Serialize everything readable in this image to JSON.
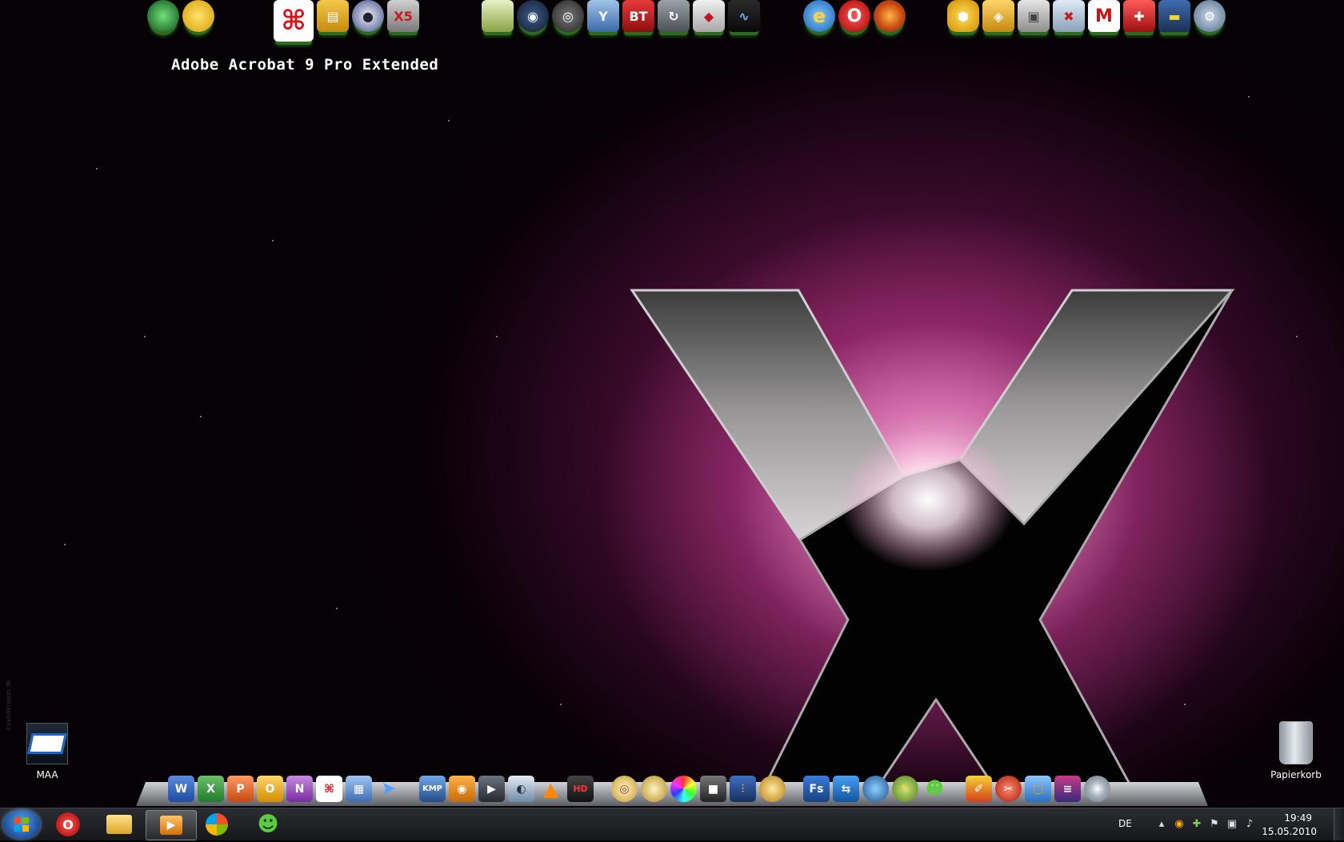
{
  "desktop": {
    "hover_label": "Adobe Acrobat 9 Pro Extended",
    "icons": [
      {
        "name": "MAA",
        "label": "MAA"
      },
      {
        "name": "recycle-bin",
        "label": "Papierkorb"
      }
    ],
    "watermark": "cvandersson.dk"
  },
  "top_dock": {
    "icons": [
      "alien-icon",
      "smiley-icon",
      "acrobat-icon",
      "office-tools-icon",
      "user-icon",
      "xara-icon",
      "notes-icon",
      "webcam-icon",
      "photoscape-icon",
      "yahoo-icon",
      "bittorrent-icon",
      "backup-icon",
      "lips-icon",
      "wave-icon",
      "ie-icon",
      "opera-icon",
      "firefox-icon",
      "hexagons-icon",
      "security-shield-icon",
      "disk-icon",
      "uninstall-icon",
      "malwarebytes-icon",
      "tools-icon",
      "flash-drive-icon",
      "settings-icon"
    ],
    "labels": {
      "bittorrent": "BT",
      "malware": "M",
      "xara": "X5"
    }
  },
  "bottom_dock": {
    "labels": {
      "word": "W",
      "excel": "X",
      "powerpoint": "P",
      "outlook": "O",
      "onenote": "N",
      "kmp": "KMP",
      "hd": "HD",
      "fs": "Fs"
    }
  },
  "taskbar": {
    "language": "DE",
    "time": "19:49",
    "date": "15.05.2010"
  },
  "colors": {
    "accent_pink": "#c03a90",
    "taskbar_bg": "#1b1d21",
    "dock_silver": "#9a9da2"
  }
}
